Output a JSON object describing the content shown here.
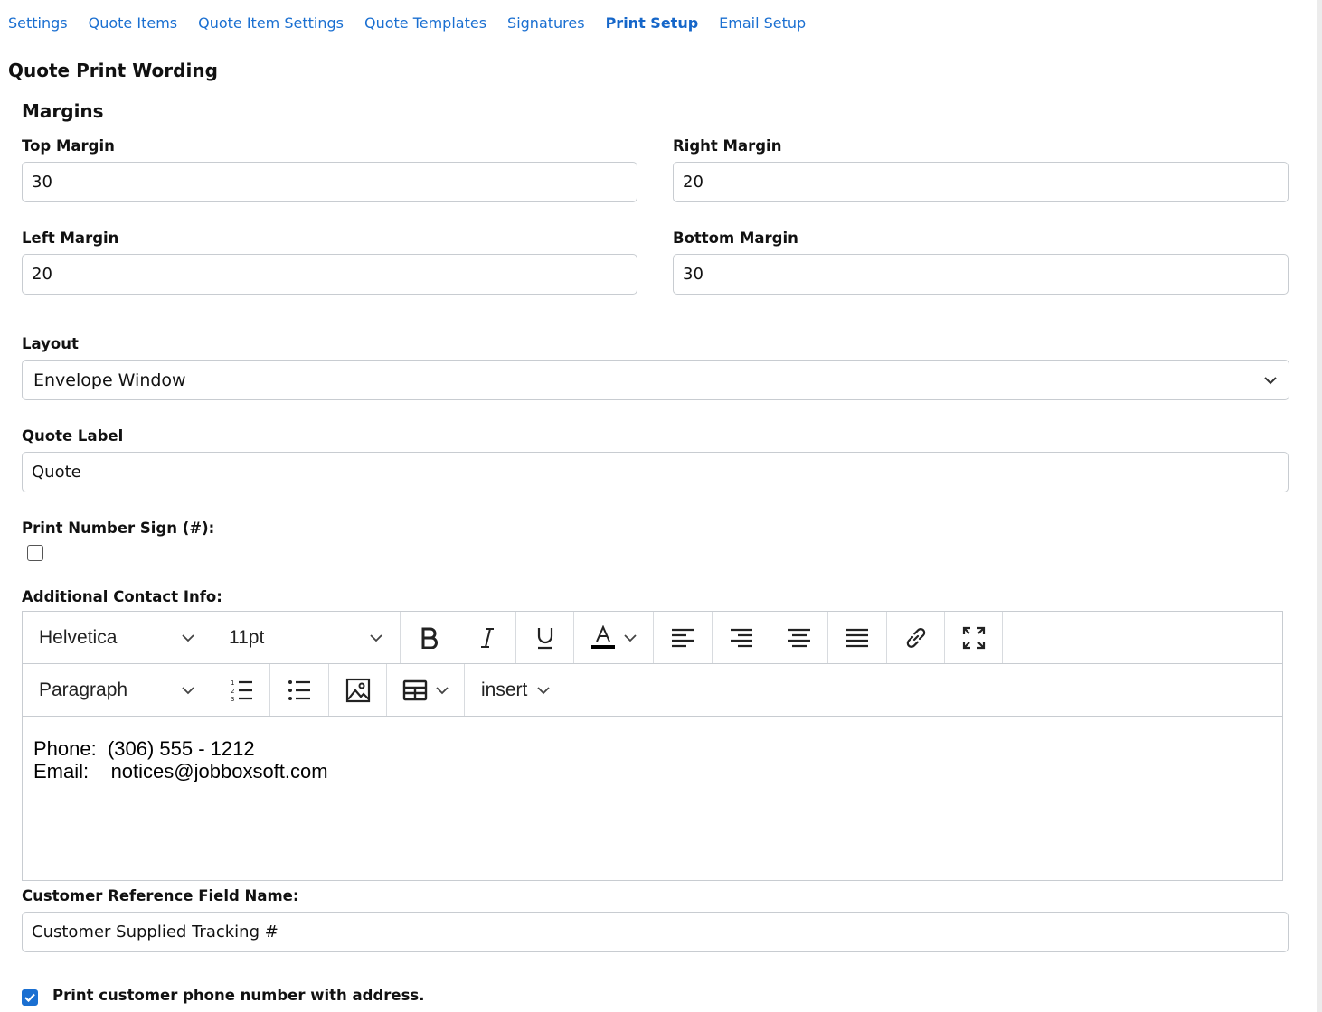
{
  "nav": {
    "tabs": [
      {
        "label": "Settings",
        "active": false
      },
      {
        "label": "Quote Items",
        "active": false
      },
      {
        "label": "Quote Item Settings",
        "active": false
      },
      {
        "label": "Quote Templates",
        "active": false
      },
      {
        "label": "Signatures",
        "active": false
      },
      {
        "label": "Print Setup",
        "active": true
      },
      {
        "label": "Email Setup",
        "active": false
      }
    ]
  },
  "page_title": "Quote Print Wording",
  "margins": {
    "title": "Margins",
    "top_label": "Top Margin",
    "top_value": "30",
    "right_label": "Right Margin",
    "right_value": "20",
    "left_label": "Left Margin",
    "left_value": "20",
    "bottom_label": "Bottom Margin",
    "bottom_value": "30"
  },
  "layout": {
    "label": "Layout",
    "value": "Envelope Window"
  },
  "quote_label": {
    "label": "Quote Label",
    "value": "Quote"
  },
  "print_number_sign": {
    "label": "Print Number Sign (#):",
    "checked": false
  },
  "contact_info": {
    "label": "Additional Contact Info:",
    "toolbar": {
      "font": "Helvetica",
      "size": "11pt",
      "block": "Paragraph",
      "insert": "insert"
    },
    "content": {
      "line1": "Phone:  (306) 555 - 1212",
      "line2": "Email:    notices@jobboxsoft.com"
    }
  },
  "customer_ref": {
    "label": "Customer Reference Field Name:",
    "value": "Customer Supplied Tracking #"
  },
  "print_phone": {
    "label": "Print customer phone number with address.",
    "checked": true
  },
  "colors": {
    "link": "#1a6fd1",
    "checkbox_checked": "#1a6fd1",
    "border": "#c8ccd1"
  }
}
